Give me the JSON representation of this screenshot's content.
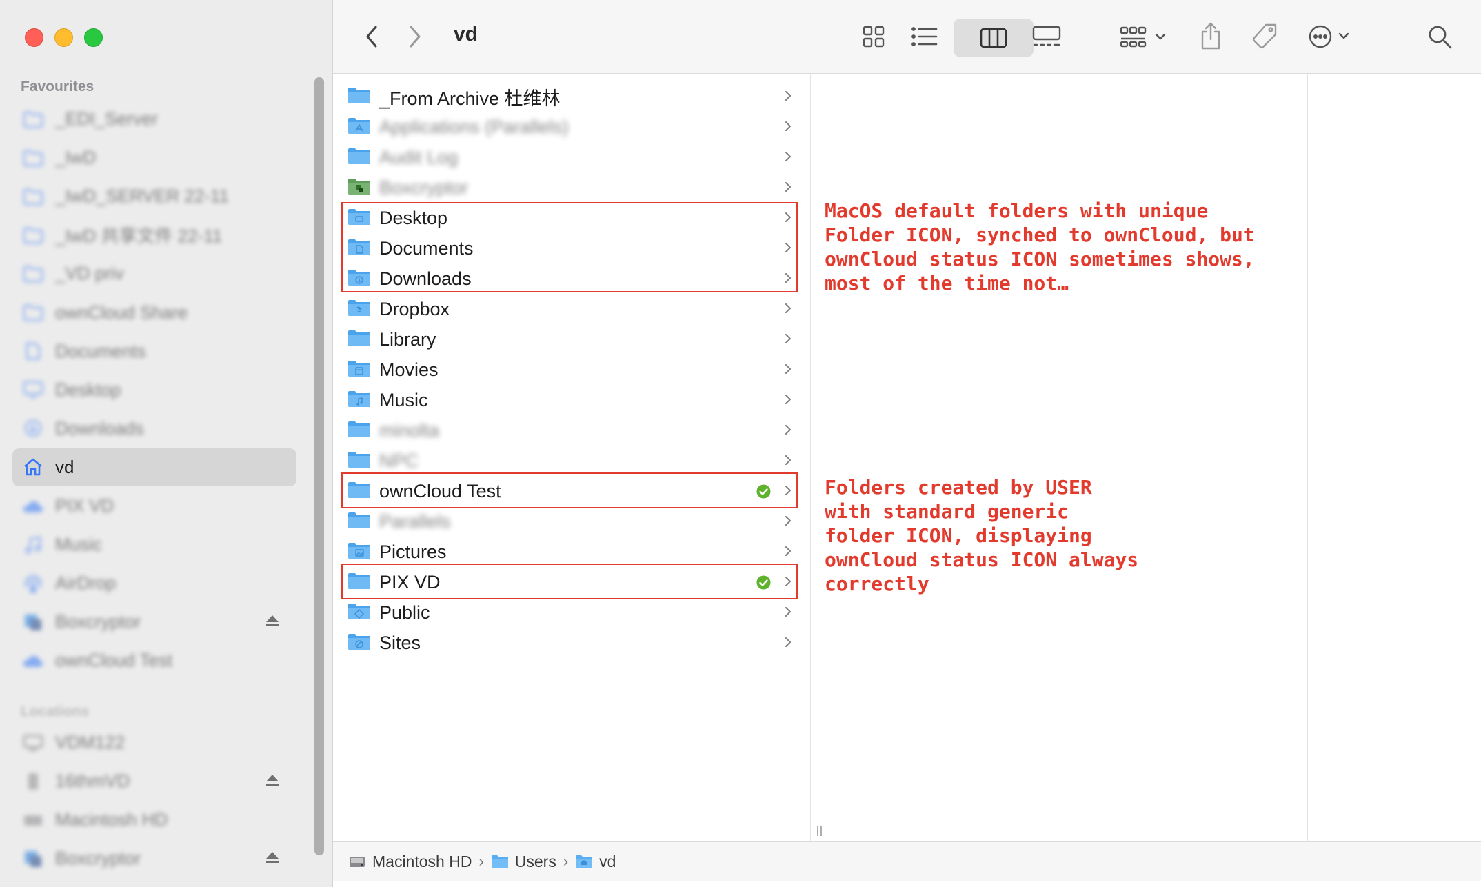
{
  "window": {
    "title": "vd"
  },
  "sidebar": {
    "favourites_header": "Favourites",
    "favourites": [
      {
        "label": "_EDI_Server",
        "icon": "folder-icon",
        "blurred": true
      },
      {
        "label": "_IwD",
        "icon": "folder-icon",
        "blurred": true
      },
      {
        "label": "_IwD_SERVER 22-11",
        "icon": "folder-icon",
        "blurred": true
      },
      {
        "label": "_IwD 共享文件 22-11",
        "icon": "folder-icon",
        "blurred": true
      },
      {
        "label": "_VD priv",
        "icon": "folder-icon",
        "blurred": true
      },
      {
        "label": "ownCloud Share",
        "icon": "folder-icon",
        "blurred": true
      },
      {
        "label": "Documents",
        "icon": "document-icon",
        "blurred": true
      },
      {
        "label": "Desktop",
        "icon": "desktop-icon",
        "blurred": true
      },
      {
        "label": "Downloads",
        "icon": "download-icon",
        "blurred": true
      },
      {
        "label": "vd",
        "icon": "home-icon",
        "blurred": false,
        "selected": true
      },
      {
        "label": "PIX VD",
        "icon": "cloud-icon",
        "blurred": true
      },
      {
        "label": "Music",
        "icon": "music-icon",
        "blurred": true
      },
      {
        "label": "AirDrop",
        "icon": "airdrop-icon",
        "blurred": true
      },
      {
        "label": "Boxcryptor",
        "icon": "boxcryptor-icon",
        "blurred": true,
        "eject": true
      },
      {
        "label": "ownCloud Test",
        "icon": "cloud-icon",
        "blurred": true
      }
    ],
    "locations_header": "Locations",
    "locations": [
      {
        "label": "VDM122",
        "icon": "computer-icon",
        "blurred": true
      },
      {
        "label": "16thmVD",
        "icon": "drive-icon",
        "blurred": true,
        "eject": true
      },
      {
        "label": "Macintosh HD",
        "icon": "disk-icon",
        "blurred": true
      },
      {
        "label": "Boxcryptor",
        "icon": "boxcryptor-icon",
        "blurred": true,
        "eject": true
      }
    ]
  },
  "toolbar": {
    "back": "back-icon",
    "forward": "forward-icon",
    "view_modes": [
      "icon-view-icon",
      "list-view-icon",
      "column-view-icon",
      "gallery-view-icon"
    ],
    "active_view": "column-view-icon",
    "group": "group-icon",
    "share": "share-icon",
    "tags": "tag-icon",
    "more": "more-icon",
    "search": "search-icon"
  },
  "column1": {
    "rows": [
      {
        "name": "_From Archive 杜维林",
        "icon": "folder-icon",
        "blurred": false
      },
      {
        "name": "Applications (Parallels)",
        "icon": "app-folder-icon",
        "blurred": true
      },
      {
        "name": "Audit Log",
        "icon": "folder-icon",
        "blurred": true
      },
      {
        "name": "Boxcryptor",
        "icon": "boxcryptor-folder-icon",
        "blurred": true
      },
      {
        "name": "Desktop",
        "icon": "desktop-folder-icon",
        "blurred": false
      },
      {
        "name": "Documents",
        "icon": "documents-folder-icon",
        "blurred": false
      },
      {
        "name": "Downloads",
        "icon": "downloads-folder-icon",
        "blurred": false
      },
      {
        "name": "Dropbox",
        "icon": "dropbox-folder-icon",
        "blurred": false
      },
      {
        "name": "Library",
        "icon": "folder-icon",
        "blurred": false
      },
      {
        "name": "Movies",
        "icon": "movies-folder-icon",
        "blurred": false
      },
      {
        "name": "Music",
        "icon": "music-folder-icon",
        "blurred": false
      },
      {
        "name": "minolta",
        "icon": "folder-icon",
        "blurred": true
      },
      {
        "name": "NPC",
        "icon": "folder-icon",
        "blurred": true
      },
      {
        "name": "ownCloud Test",
        "icon": "folder-icon",
        "blurred": false,
        "synced": true
      },
      {
        "name": "Parallels",
        "icon": "folder-icon",
        "blurred": true
      },
      {
        "name": "Pictures",
        "icon": "pictures-folder-icon",
        "blurred": false
      },
      {
        "name": "PIX VD",
        "icon": "folder-icon",
        "blurred": false,
        "synced": true
      },
      {
        "name": "Public",
        "icon": "public-folder-icon",
        "blurred": false
      },
      {
        "name": "Sites",
        "icon": "sites-folder-icon",
        "blurred": false
      }
    ]
  },
  "annotations": {
    "top": "MacOS default folders with unique\nFolder ICON, synched to ownCloud, but\nownCloud status ICON sometimes shows,\nmost of the time not…",
    "bottom": "Folders created by USER\nwith standard generic\nfolder ICON, displaying\nownCloud status ICON always\ncorrectly"
  },
  "pathbar": {
    "items": [
      {
        "label": "Macintosh HD",
        "icon": "disk-icon"
      },
      {
        "label": "Users",
        "icon": "folder-icon"
      },
      {
        "label": "vd",
        "icon": "home-folder-icon"
      }
    ],
    "separator": "›"
  },
  "colors": {
    "accent": "#3478f6",
    "folder": "#5aaef0",
    "annotation": "#e23b2e",
    "sync_ok": "#5fb32c"
  }
}
